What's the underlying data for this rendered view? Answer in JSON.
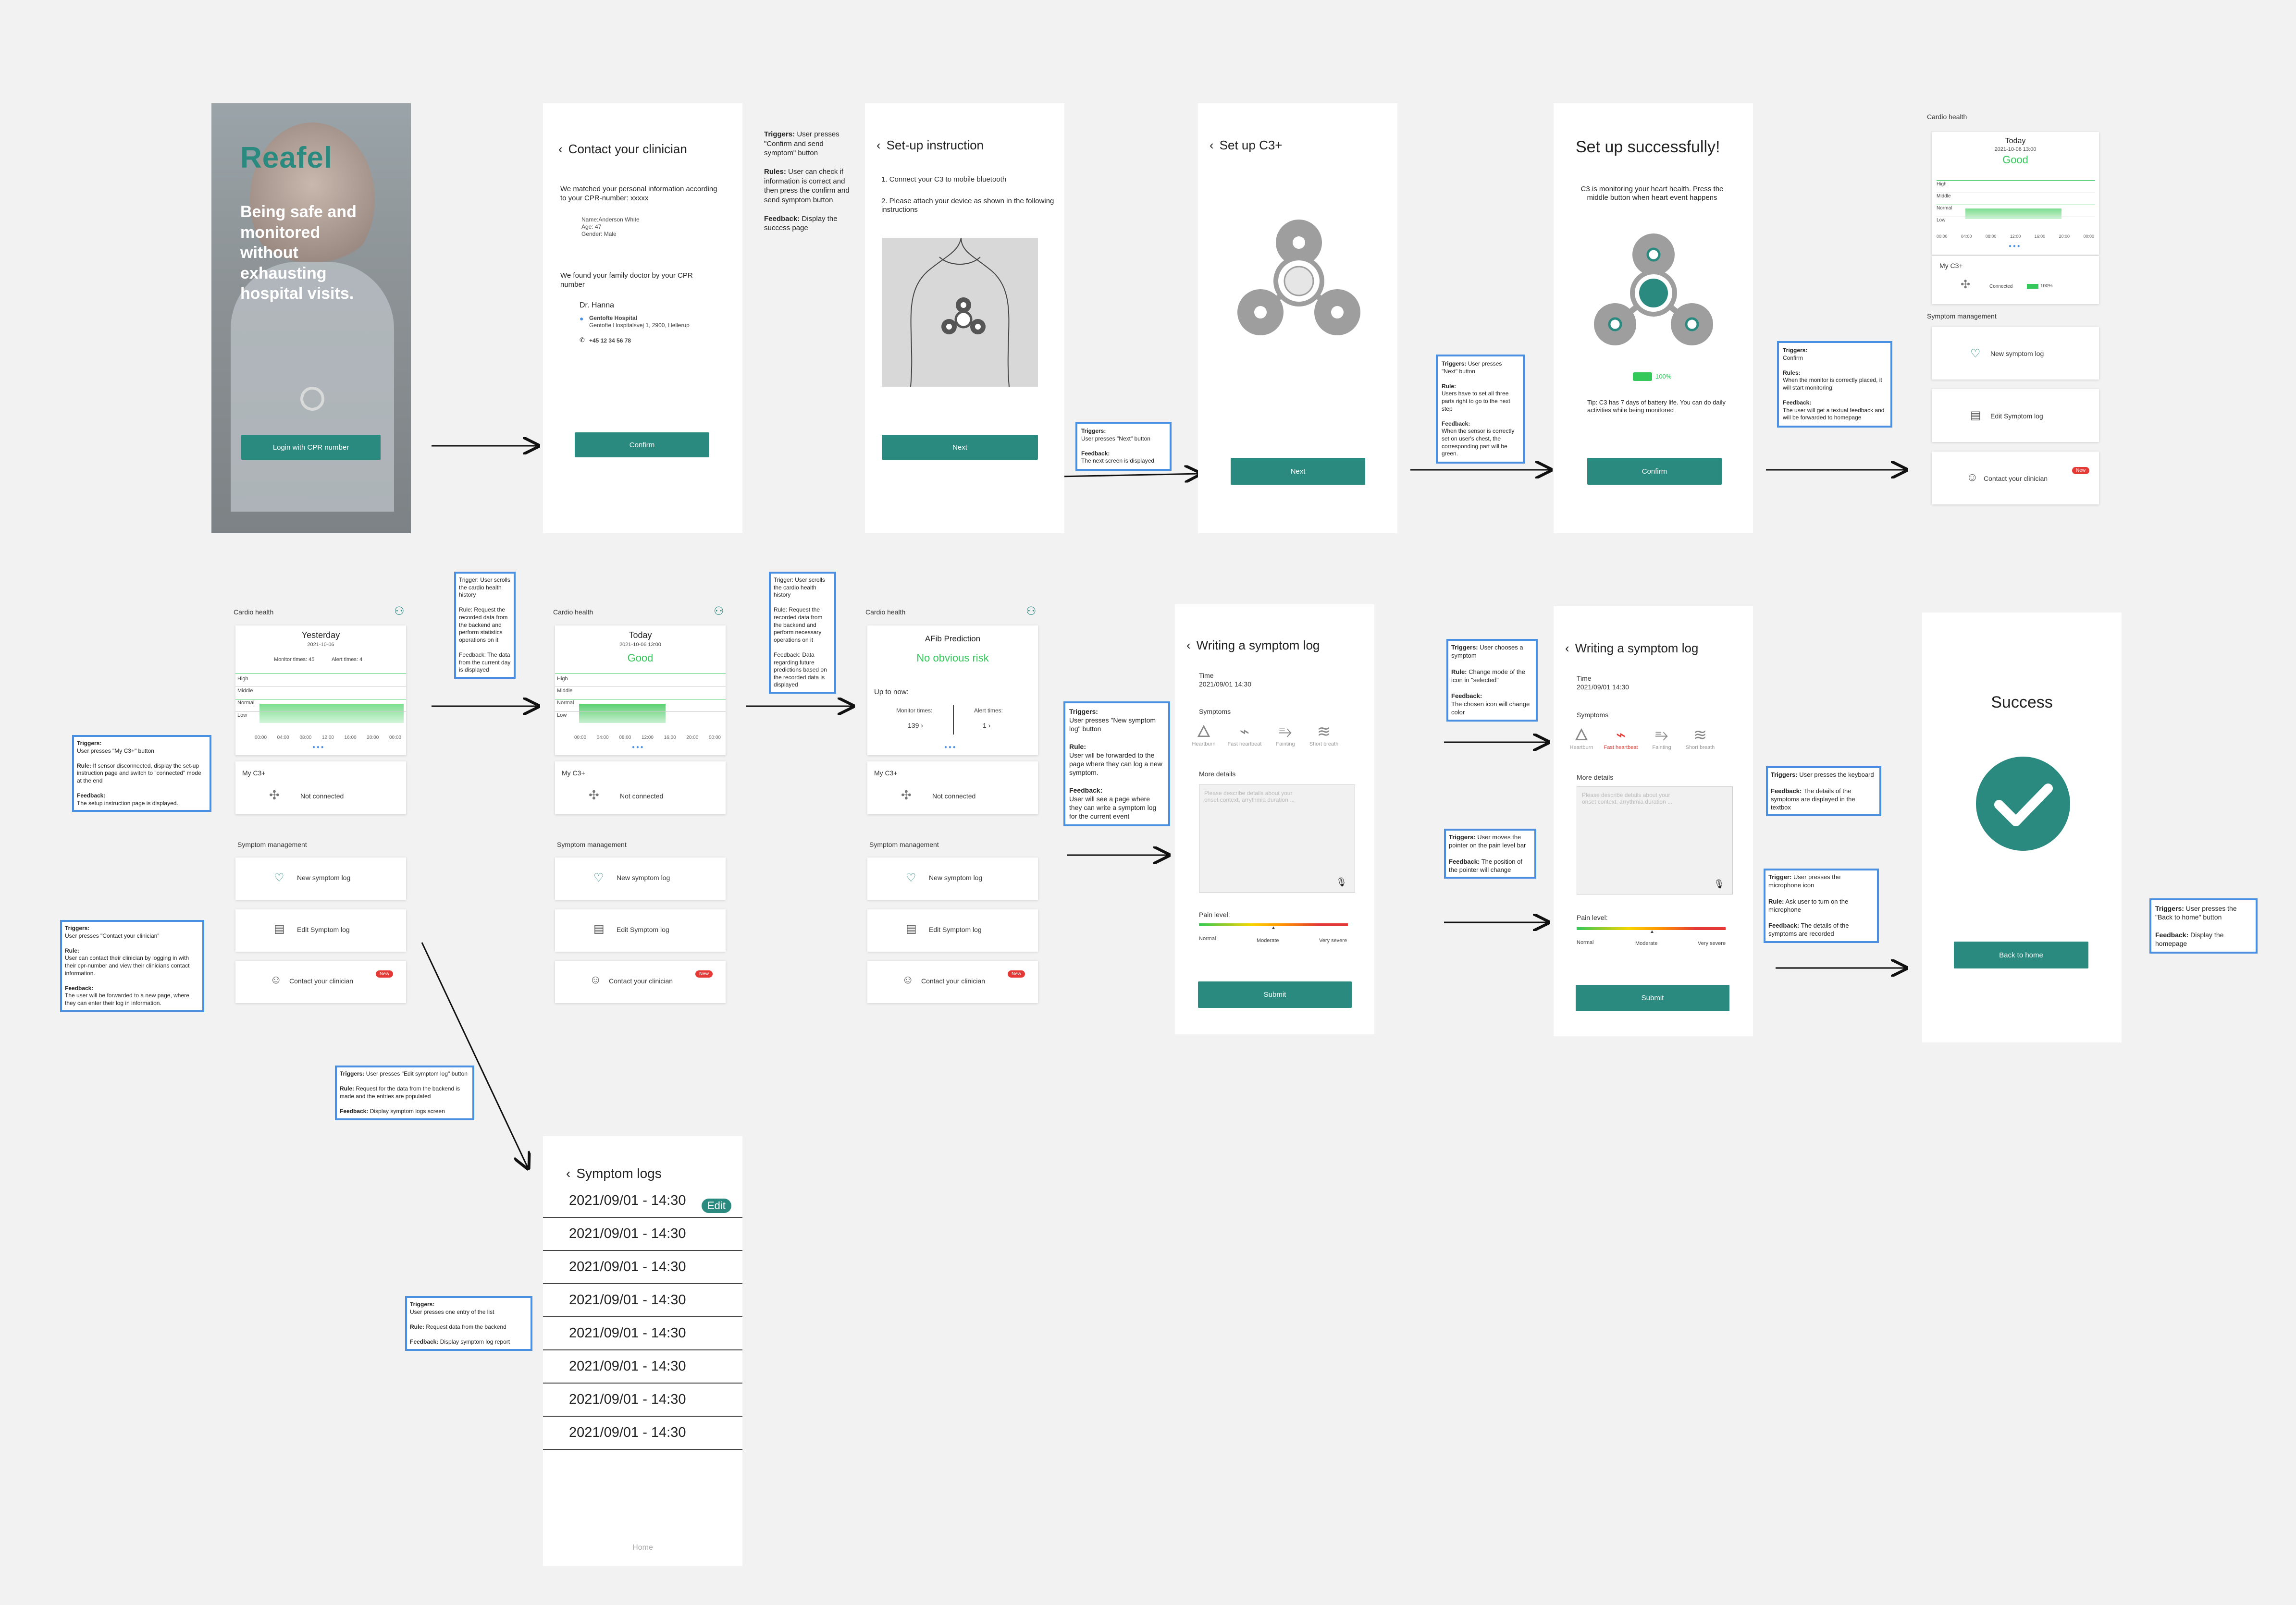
{
  "colors": {
    "teal": "#2a8a7f",
    "green": "#34c759",
    "link": "#4a90e2",
    "badge": "#e53935"
  },
  "login": {
    "brand": "Reafel",
    "tagline": "Being safe and monitored without exhausting hospital visits.",
    "button": "Login with CPR number"
  },
  "contact": {
    "title": "Contact your clinician",
    "intro": "We matched your personal information according to your CPR-number: xxxxx",
    "name": "Name:Anderson White",
    "age": "Age: 47",
    "gender": "Gender: Male",
    "found": "We found your family doctor by your CPR number",
    "doctor": "Dr. Hanna",
    "clinic": "Gentofte Hospital",
    "address": "Gentofte Hospitalsvej 1, 2900, Hellerup",
    "phone": "+45 12 34 56 78",
    "button": "Confirm"
  },
  "note_contact": {
    "l1": "Triggers:",
    "l1b": "User presses \"Confirm and send symptom\" button",
    "l2": "Rules:",
    "l2b": "User can check if information is correct and then press the confirm and send symptom button",
    "l3": "Feedback:",
    "l3b": "Display the success page"
  },
  "setup": {
    "title": "Set-up instruction",
    "step1": "1. Connect your C3 to mobile bluetooth",
    "step2": "2. Please attach your device as shown in the following instructions",
    "button": "Next"
  },
  "note_next1": {
    "l1": "Triggers:",
    "l1b": "User presses \"Next\" button",
    "l3": "Feedback:",
    "l3b": "The next screen is displayed"
  },
  "setupc3": {
    "title": "Set up C3+",
    "button": "Next"
  },
  "note_next2": {
    "l1": "Triggers:",
    "l1b": "User presses \"Next\" button",
    "l2": "Rule:",
    "l2b": "Users have to set all three parts right to go to the next step",
    "l3": "Feedback:",
    "l3b": "When the sensor is correctly set on user's chest, the corresponding part will be green."
  },
  "success1": {
    "title": "Set up successfully!",
    "desc": "C3 is monitoring your heart health. Press the middle button when heart event happens",
    "battery": "100%",
    "tip": "Tip: C3 has 7 days of battery life. You can do daily activities while being monitored",
    "button": "Confirm"
  },
  "note_confirm": {
    "l1": "Triggers:",
    "l1b": "Confirm",
    "l2": "Rules:",
    "l2b": "When the monitor is correctly placed, it will start monitoring.",
    "l3": "Feedback:",
    "l3b": "The user will get a textual feedback and will be forwarded to homepage"
  },
  "home_small": {
    "section": "Cardio health",
    "day": "Today",
    "date": "2021-10-06 13:00",
    "status": "Good",
    "levels": [
      "High",
      "Middle",
      "Normal",
      "Low"
    ],
    "times": [
      "00:00",
      "04:00",
      "08:00",
      "12:00",
      "16:00",
      "20:00",
      "00:00"
    ],
    "myc3": "My C3+",
    "connected": "Connected",
    "battery": "100%",
    "mgmt": "Symptom management",
    "new_log": "New symptom log",
    "edit_log": "Edit Symptom log",
    "contact": "Contact your clinician",
    "badge": "New"
  },
  "home_y": {
    "section": "Cardio health",
    "day": "Yesterday",
    "date": "2021-10-06",
    "monitor": "Monitor times: 45",
    "alert": "Alert times: 4",
    "levels": [
      "High",
      "Middle",
      "Normal",
      "Low"
    ],
    "times": [
      "00:00",
      "04:00",
      "08:00",
      "12:00",
      "16:00",
      "20:00",
      "00:00"
    ],
    "myc3": "My C3+",
    "not_connected": "Not connected",
    "mgmt": "Symptom management",
    "new_log": "New symptom log",
    "edit_log": "Edit Symptom log",
    "contact": "Contact your clinician",
    "badge": "New"
  },
  "home_t": {
    "section": "Cardio health",
    "day": "Today",
    "date": "2021-10-06 13:00",
    "status": "Good",
    "levels": [
      "High",
      "Middle",
      "Normal",
      "Low"
    ],
    "times": [
      "00:00",
      "04:00",
      "08:00",
      "12:00",
      "16:00",
      "20:00",
      "00:00"
    ],
    "myc3": "My C3+",
    "not_connected": "Not connected",
    "mgmt": "Symptom management",
    "new_log": "New symptom log",
    "edit_log": "Edit Symptom log",
    "contact": "Contact your clinician",
    "badge": "New"
  },
  "home_a": {
    "section": "Cardio health",
    "afib": "AFib Prediction",
    "risk": "No obvious risk",
    "upto": "Up to now:",
    "monitor_l": "Monitor times:",
    "monitor_v": "139",
    "alert_l": "Alert times:",
    "alert_v": "1",
    "myc3": "My C3+",
    "not_connected": "Not connected",
    "mgmt": "Symptom management",
    "new_log": "New symptom log",
    "edit_log": "Edit Symptom log",
    "contact": "Contact your clinician",
    "badge": "New"
  },
  "note_scroll1": {
    "l1": "Trigger: User scrolls the cardio health history",
    "l2": "Rule: Request the recorded data from the backend and perform statistics operations on it",
    "l3": "Feedback: The data from the current day is displayed"
  },
  "note_scroll2": {
    "l1": "Trigger: User scrolls the cardio health history",
    "l2": "Rule: Request the recorded data from the backend and perform necessary operations on it",
    "l3": "Feedback: Data regarding future predictions based on the recorded data is displayed"
  },
  "note_myc3": {
    "l1": "Triggers:",
    "l1b": "User presses \"My C3+\" button",
    "l2": "Rule:",
    "l2b": "If sensor disconnected, display the set-up instruction page and switch to \"connected\" mode at the end",
    "l3": "Feedback:",
    "l3b": "The setup instruction page is displayed."
  },
  "note_contactclin": {
    "l1": "Triggers:",
    "l1b": "User presses \"Contact your clinician\"",
    "l2": "Rule:",
    "l2b": "User can contact their clinician by logging in with their cpr-number and view their clinicians contact information.",
    "l3": "Feedback:",
    "l3b": "The user will be forwarded to a new page, where they can enter their log in information."
  },
  "note_edit": {
    "l1": "Triggers:",
    "l1b": "User presses \"Edit symptom log\" button",
    "l2": "Rule:",
    "l2b": "Request for the data from the backend is made and the entries are populated",
    "l3": "Feedback:",
    "l3b": "Display symptom logs screen"
  },
  "note_newlog": {
    "l1": "Triggers:",
    "l1b": "User presses \"New symptom log\" button",
    "l2": "Rule:",
    "l2b": "User will be forwarded to the page where they can log a new symptom.",
    "l3": "Feedback:",
    "l3b": "User will see a page where they can write a symptom log for the current event"
  },
  "log1": {
    "title": "Writing a symptom log",
    "time_l": "Time",
    "time_v": "2021/09/01 14:30",
    "symptoms": "Symptoms",
    "items": [
      "Heartburn",
      "Fast heartbeat",
      "Fainting",
      "Short breath"
    ],
    "details": "More details",
    "placeholder": "Please describe details about your onset context, arrythmia duration ...",
    "pain": "Pain level:",
    "scale": [
      "Normal",
      "Moderate",
      "Very severe"
    ],
    "button": "Submit"
  },
  "note_choose": {
    "l1": "Triggers:",
    "l1b": "User chooses a symptom",
    "l2": "Rule:",
    "l2b": "Change mode of the icon in \"selected\"",
    "l3": "Feedback:",
    "l3b": "The chosen icon will change color"
  },
  "note_pain": {
    "l1": "Triggers:",
    "l1b": "User moves the pointer on the pain level bar",
    "l3": "Feedback:",
    "l3b": "The position of the pointer will change"
  },
  "log2": {
    "title": "Writing a symptom log",
    "time_l": "Time",
    "time_v": "2021/09/01 14:30",
    "symptoms": "Symptoms",
    "items": [
      "Heartburn",
      "Fast heartbeat",
      "Fainting",
      "Short breath"
    ],
    "details": "More details",
    "placeholder": "Please describe details about your onset context, arrythmia duration ...",
    "pain": "Pain level:",
    "scale": [
      "Normal",
      "Moderate",
      "Very severe"
    ],
    "button": "Submit"
  },
  "note_keyboard": {
    "l1": "Triggers:",
    "l1b": "User presses the keyboard",
    "l3": "Feedback:",
    "l3b": "The details of the symptoms are displayed in the textbox"
  },
  "note_mic": {
    "l1": "Trigger:",
    "l1b": "User presses the microphone icon",
    "l2": "Rule:",
    "l2b": "Ask user to turn on the microphone",
    "l3": "Feedback:",
    "l3b": "The details of the symptoms are recorded"
  },
  "success2": {
    "title": "Success",
    "button": "Back to home"
  },
  "note_back": {
    "l1": "Triggers:",
    "l1b": "User presses the \"Back to home\" button",
    "l3": "Feedback:",
    "l3b": "Display the homepage"
  },
  "logs": {
    "title": "Symptom logs",
    "edit": "Edit",
    "entries": [
      "2021/09/01 -  14:30",
      "2021/09/01 -  14:30",
      "2021/09/01 -  14:30",
      "2021/09/01 -  14:30",
      "2021/09/01 -  14:30",
      "2021/09/01 -  14:30",
      "2021/09/01 -  14:30",
      "2021/09/01 -  14:30"
    ],
    "footer": "Home"
  },
  "note_entry": {
    "l1": "Triggers:",
    "l1b": "User presses one entry of the list",
    "l2": "Rule:",
    "l2b": "Request data from the backend",
    "l3": "Feedback:",
    "l3b": "Display symptom log report"
  }
}
